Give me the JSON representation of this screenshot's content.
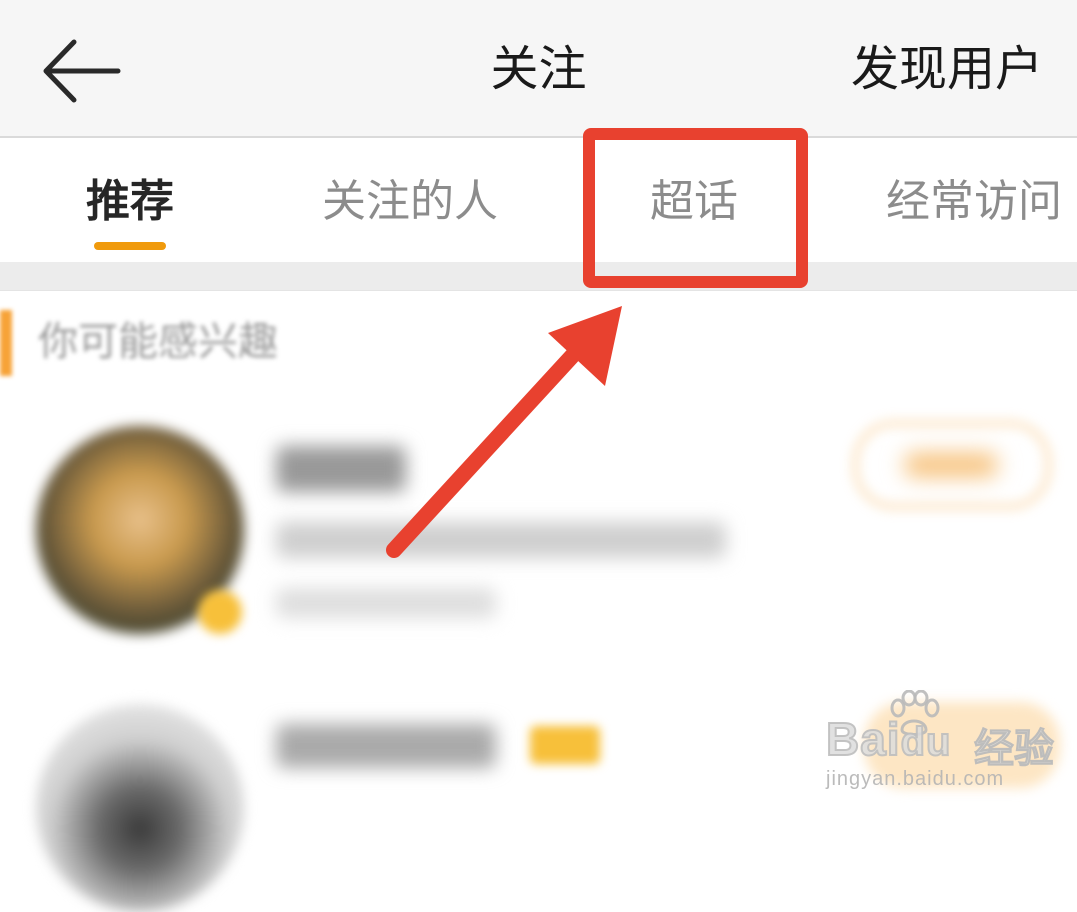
{
  "header": {
    "title": "关注",
    "action_label": "发现用户",
    "back_icon": "arrow-left-icon"
  },
  "tabs": [
    {
      "label": "推荐",
      "active": true
    },
    {
      "label": "关注的人",
      "active": false
    },
    {
      "label": "超话",
      "active": false
    },
    {
      "label": "经常访问",
      "active": false
    }
  ],
  "section": {
    "title": "你可能感兴趣"
  },
  "suggestions": [
    {
      "name": "",
      "follow_label": "",
      "has_badge": true
    },
    {
      "name": "",
      "follow_label": "",
      "has_badge": true
    }
  ],
  "annotation": {
    "highlight_color": "#e8412f",
    "target": "超话"
  },
  "watermark": {
    "brand": "Bai",
    "brand_suffix": "du",
    "product": "经验",
    "url": "jingyan.baidu.com"
  },
  "colors": {
    "accent": "#f09a0c",
    "header_bg": "#f6f6f6",
    "annotation_red": "#e8412f"
  }
}
